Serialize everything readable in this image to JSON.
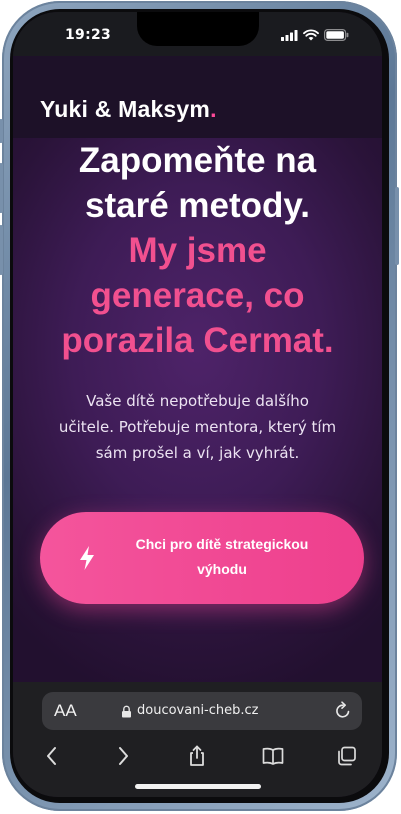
{
  "status_bar": {
    "time": "19:23"
  },
  "header": {
    "logo_text": "Yuki & Maksym",
    "logo_dot": "."
  },
  "hero": {
    "headline_white": [
      "Zapomeňte na",
      "staré metody."
    ],
    "headline_pink": [
      "My jsme",
      "generace, co",
      "porazila Cermat."
    ],
    "subtext": [
      "Vaše dítě nepotřebuje dalšího",
      "učitele. Potřebuje mentora, který tím",
      "sám prošel a ví, jak vyhrát."
    ],
    "cta": {
      "label": [
        "Chci pro dítě strategickou",
        "výhodu"
      ],
      "icon": "lightning-bolt-icon"
    }
  },
  "browser": {
    "text_size_button": "AA",
    "url": "doucovani-cheb.cz",
    "icons": [
      "lock-icon",
      "reload-icon",
      "back-icon",
      "forward-icon",
      "share-icon",
      "bookmarks-icon",
      "tabs-icon"
    ]
  },
  "colors": {
    "accent_pink": "#f1508f",
    "cta_pink": "#f04592",
    "hero_purple": "#4e2369",
    "header_bg": "#1d1128"
  }
}
